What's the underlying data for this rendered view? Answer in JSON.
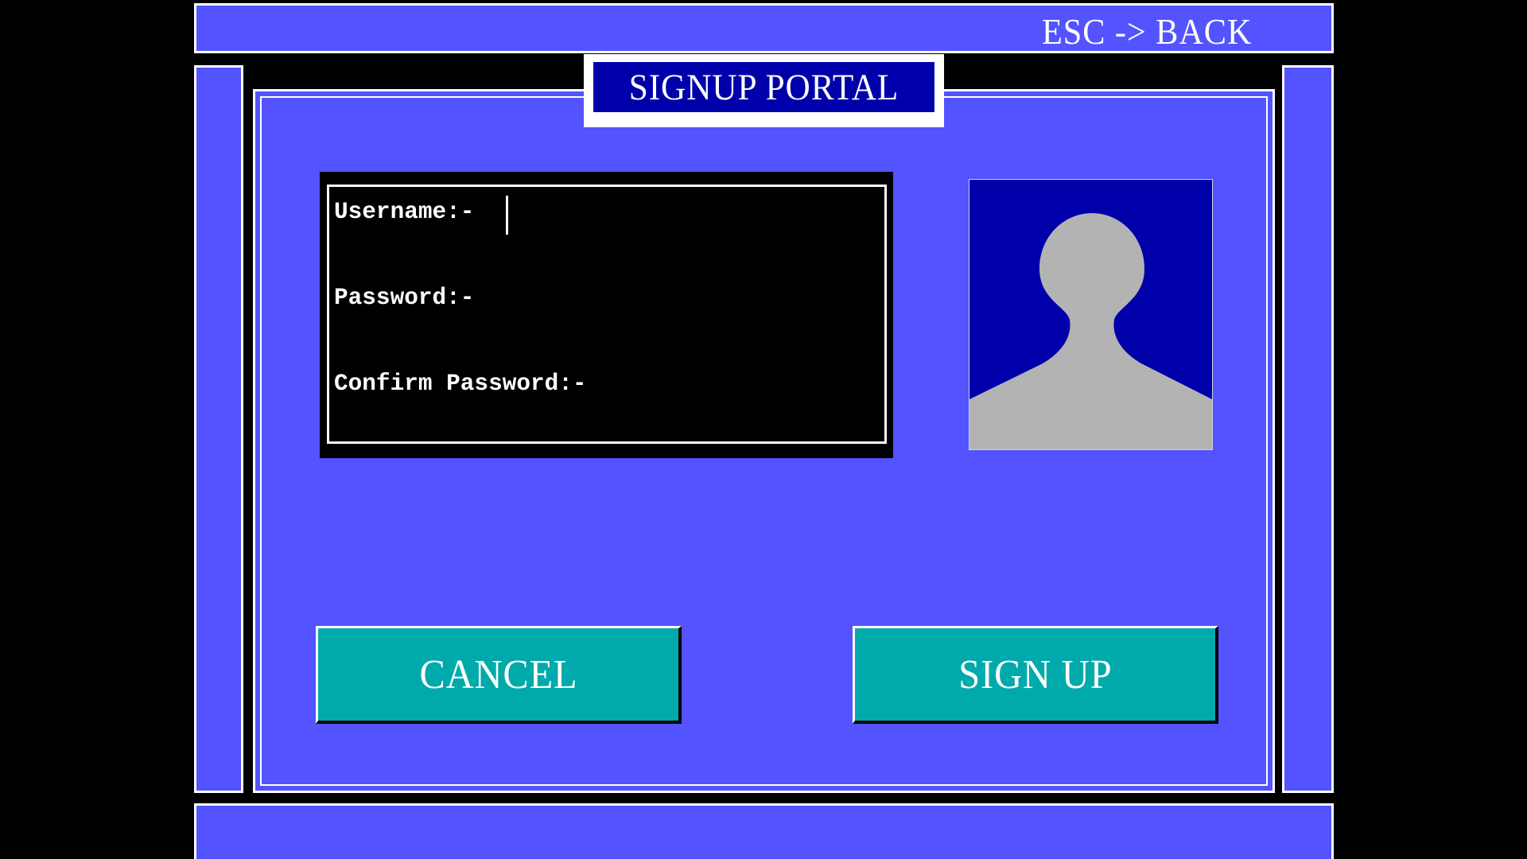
{
  "header": {
    "back_hint": "ESC -> BACK"
  },
  "portal": {
    "title": "SIGNUP PORTAL"
  },
  "form": {
    "username_label": "Username:-",
    "password_label": "Password:-",
    "confirm_password_label": "Confirm Password:-",
    "username_value": "",
    "password_value": "",
    "confirm_password_value": ""
  },
  "avatar": {
    "icon": "user-silhouette-icon"
  },
  "actions": {
    "cancel_label": "CANCEL",
    "signup_label": "SIGN UP"
  },
  "colors": {
    "background": "#5353ff",
    "title_fill": "#0000aa",
    "button_fill": "#00aaaa",
    "avatar_bg": "#0000aa",
    "avatar_figure": "#b3b3b3",
    "form_bg": "#000000"
  }
}
